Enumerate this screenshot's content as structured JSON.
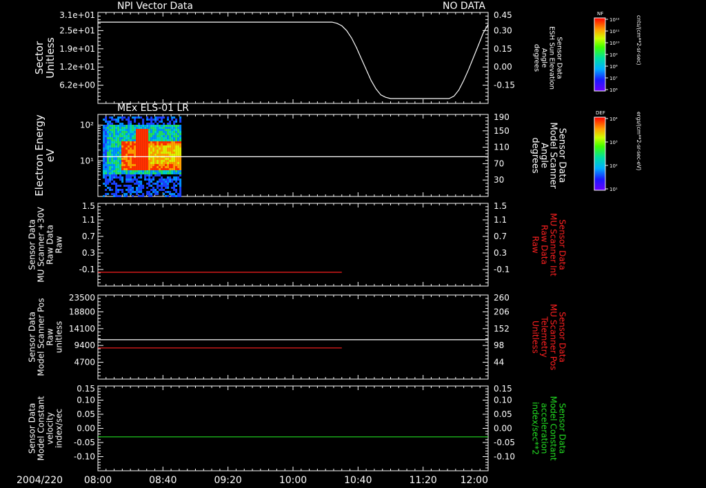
{
  "date_label": "2004/220",
  "time_ticks": [
    "08:00",
    "08:40",
    "09:20",
    "10:00",
    "10:40",
    "11:20",
    "12:00"
  ],
  "colors": {
    "white": "#ffffff",
    "red": "#ff2020",
    "green": "#22dd22"
  },
  "colorbars": [
    {
      "top_label": "NF",
      "tick_labels": [
        "10¹²",
        "10¹¹",
        "10¹⁰",
        "10⁹",
        "10⁸",
        "10⁷",
        "10⁶"
      ],
      "unit_label": "cnts/(cm**2-sr-sec)"
    },
    {
      "top_label": "DEF",
      "tick_labels": [
        "10⁴",
        "10³",
        "10²",
        "10¹"
      ],
      "unit_label": "ergs/(cm**2-sr-sec-eV)"
    }
  ],
  "chart_data": [
    {
      "type": "line",
      "panel_title_left": "NPI Vector Data",
      "panel_title_right": "NO DATA",
      "left_axis_label": [
        "Sector",
        "Unitless"
      ],
      "left_ticks": [
        "3.1e+01",
        "2.5e+01",
        "1.9e+01",
        "1.2e+01",
        "6.2e+00"
      ],
      "right_axis_label": [
        "Sensor Data",
        "ESH Sun Elevation",
        "Angle",
        "degrees"
      ],
      "right_ticks": [
        "0.45",
        "0.30",
        "0.15",
        "0.00",
        "-0.15"
      ],
      "right_ylim": [
        -0.3,
        0.45
      ],
      "series": [
        {
          "axis": "right",
          "color": "white",
          "x_hours": [
            8.0,
            10.4,
            10.45,
            10.5,
            10.55,
            10.6,
            10.65,
            10.7,
            10.75,
            10.8,
            10.85,
            10.9,
            10.95,
            11.0,
            11.6,
            11.65,
            11.7,
            11.75,
            11.8,
            11.85,
            11.9,
            11.95,
            12.0
          ],
          "y": [
            0.37,
            0.37,
            0.36,
            0.34,
            0.3,
            0.24,
            0.16,
            0.07,
            -0.02,
            -0.11,
            -0.18,
            -0.23,
            -0.25,
            -0.26,
            -0.26,
            -0.24,
            -0.19,
            -0.11,
            -0.02,
            0.08,
            0.18,
            0.28,
            0.35
          ]
        }
      ]
    },
    {
      "type": "heatmap",
      "panel_title_left": "MEx ELS-01 LR",
      "left_axis_label": [
        "Electron Energy",
        "eV"
      ],
      "left_log_ticks": [
        "10²",
        "10¹"
      ],
      "left_log_range": [
        1,
        200
      ],
      "right_axis_label": [
        "Sensor Data",
        "Model Scanner",
        "Angle",
        "degrees"
      ],
      "right_ticks": [
        "190",
        "150",
        "110",
        "70",
        "30"
      ],
      "right_ylim": [
        0,
        190
      ],
      "spectrogram_x_range_hours": [
        8.05,
        8.85
      ],
      "series": [
        {
          "axis": "right",
          "color": "white",
          "x_hours": [
            8.0,
            12.0
          ],
          "y": [
            92,
            92
          ]
        }
      ]
    },
    {
      "type": "line",
      "left_axis_label": [
        "Sensor Data",
        "MU Scanner +30V",
        "Raw Data",
        "Raw"
      ],
      "left_ticks": [
        "1.5",
        "1.1",
        "0.7",
        "0.3",
        "-0.1"
      ],
      "left_ylim": [
        -0.3,
        1.5
      ],
      "right_axis_label": [
        "Sensor Data",
        "MU Scanner Int",
        "Raw Data",
        "Raw"
      ],
      "right_ticks": [
        "1.5",
        "1.1",
        "0.7",
        "0.3",
        "-0.1"
      ],
      "right_ylim": [
        -0.3,
        1.5
      ],
      "series": [
        {
          "axis": "left",
          "color": "red",
          "x_hours": [
            8.0,
            10.5
          ],
          "y": [
            0.0,
            0.0
          ]
        }
      ]
    },
    {
      "type": "line",
      "left_axis_label": [
        "Sensor Data",
        "Model Scanner Pos",
        "Raw",
        "unitless"
      ],
      "left_ticks": [
        "23500",
        "18800",
        "14100",
        "9400",
        "4700"
      ],
      "left_ylim": [
        0,
        23500
      ],
      "right_axis_label": [
        "Sensor Data",
        "MU Scanner Pos",
        "Telemetry",
        "Unitless"
      ],
      "right_ticks": [
        "260",
        "206",
        "152",
        "98",
        "44"
      ],
      "right_ylim": [
        0,
        260
      ],
      "series": [
        {
          "axis": "left",
          "color": "white",
          "x_hours": [
            8.0,
            12.0
          ],
          "y": [
            11000,
            11000
          ]
        },
        {
          "axis": "left",
          "color": "red",
          "x_hours": [
            8.0,
            10.5
          ],
          "y": [
            8700,
            8700
          ]
        }
      ]
    },
    {
      "type": "line",
      "left_axis_label": [
        "Sensor Data",
        "Model Constant",
        "velocity",
        "index/sec"
      ],
      "left_ticks": [
        "0.15",
        "0.10",
        "0.05",
        "0.00",
        "-0.05",
        "-0.10"
      ],
      "left_ylim": [
        -0.1,
        0.15
      ],
      "right_axis_label": [
        "Sensor Data",
        "Model Constant",
        "acceleration",
        "index/sec**2"
      ],
      "right_ticks": [
        "0.15",
        "0.10",
        "0.05",
        "0.00",
        "-0.05",
        "-0.10"
      ],
      "right_ylim": [
        -0.1,
        0.15
      ],
      "series": [
        {
          "axis": "left",
          "color": "green",
          "x_hours": [
            8.0,
            12.0
          ],
          "y": [
            0.0,
            0.0
          ]
        }
      ]
    }
  ]
}
